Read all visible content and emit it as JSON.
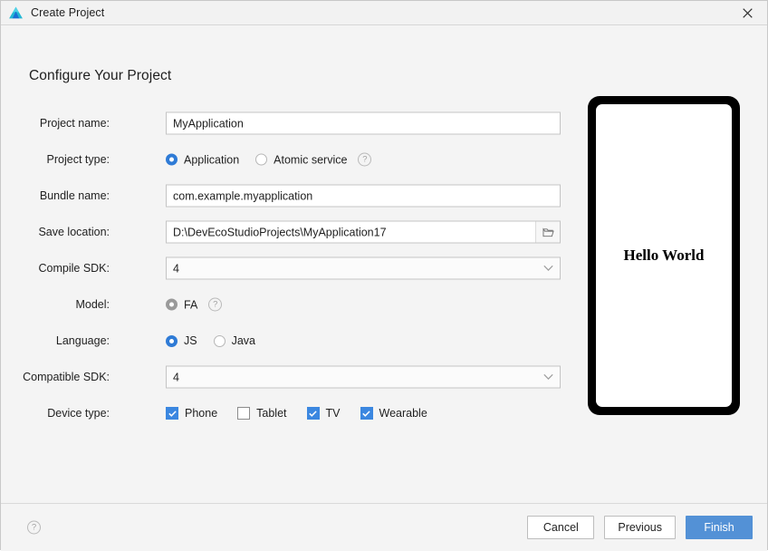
{
  "window": {
    "title": "Create Project",
    "logo_icon": "deveco-studio-logo-icon",
    "close_icon": "close-icon"
  },
  "heading": "Configure Your Project",
  "form": {
    "project_name": {
      "label": "Project name:",
      "value": "MyApplication",
      "placeholder": "Project name"
    },
    "project_type": {
      "label": "Project type:",
      "options": [
        {
          "label": "Application",
          "selected": true
        },
        {
          "label": "Atomic service",
          "selected": false
        }
      ],
      "help_icon": "help-circle-icon"
    },
    "bundle_name": {
      "label": "Bundle name:",
      "value": "com.example.myapplication",
      "placeholder": "Bundle name"
    },
    "save_location": {
      "label": "Save location:",
      "value": "D:\\DevEcoStudioProjects\\MyApplication17",
      "placeholder": "Save location",
      "browse_icon": "folder-icon"
    },
    "compile_sdk": {
      "label": "Compile SDK:",
      "value": "4",
      "chevron_icon": "chevron-down-icon"
    },
    "model": {
      "label": "Model:",
      "options": [
        {
          "label": "FA",
          "selected": true
        }
      ],
      "help_icon": "help-circle-icon"
    },
    "language": {
      "label": "Language:",
      "options": [
        {
          "label": "JS",
          "selected": true
        },
        {
          "label": "Java",
          "selected": false
        }
      ]
    },
    "compatible_sdk": {
      "label": "Compatible SDK:",
      "value": "4",
      "chevron_icon": "chevron-down-icon"
    },
    "device_type": {
      "label": "Device type:",
      "options": [
        {
          "label": "Phone",
          "checked": true
        },
        {
          "label": "Tablet",
          "checked": false
        },
        {
          "label": "TV",
          "checked": true
        },
        {
          "label": "Wearable",
          "checked": true
        }
      ]
    }
  },
  "preview": {
    "text": "Hello World"
  },
  "footer": {
    "help_icon": "help-circle-icon",
    "cancel_label": "Cancel",
    "previous_label": "Previous",
    "finish_label": "Finish"
  },
  "colors": {
    "accent_blue": "#2f7bd6",
    "primary_button": "#5391d6",
    "checkbox_blue": "#3b87e0",
    "disabled_gray": "#9a9a9a",
    "body_background": "#f4f4f4"
  }
}
